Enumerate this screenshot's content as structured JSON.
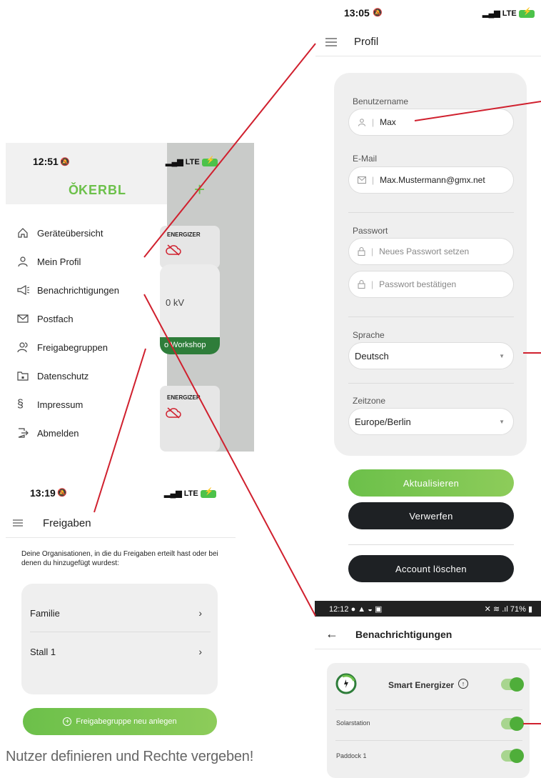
{
  "drawer": {
    "time": "12:51",
    "network": "LTE",
    "brand": "KERBL",
    "brand_mark": "Ǒ",
    "plus": "+",
    "items": [
      {
        "label": "Geräteübersicht",
        "icon": "home-icon"
      },
      {
        "label": "Mein Profil",
        "icon": "person-icon"
      },
      {
        "label": "Benachrichtigungen",
        "icon": "megaphone-icon"
      },
      {
        "label": "Postfach",
        "icon": "mail-icon"
      },
      {
        "label": "Freigabegruppen",
        "icon": "group-icon"
      },
      {
        "label": "Datenschutz",
        "icon": "folder-lock-icon"
      },
      {
        "label": "Impressum",
        "icon": "paragraph-icon"
      },
      {
        "label": "Abmelden",
        "icon": "logout-icon"
      }
    ],
    "bg_brand_1": "ENERGIZER",
    "bg_brand_2": "ENERGIZER",
    "bg_voltage": "0 kV",
    "bg_workshop": "o Workshop"
  },
  "profile": {
    "time": "13:05",
    "network": "LTE",
    "title": "Profil",
    "username_label": "Benutzername",
    "username_value": "Max",
    "email_label": "E-Mail",
    "email_value": "Max.Mustermann@gmx.net",
    "password_label": "Passwort",
    "password_placeholder": "Neues Passwort setzen",
    "password_confirm_placeholder": "Passwort bestätigen",
    "language_label": "Sprache",
    "language_value": "Deutsch",
    "timezone_label": "Zeitzone",
    "timezone_value": "Europe/Berlin",
    "update_button": "Aktualisieren",
    "discard_button": "Verwerfen",
    "delete_button": "Account löschen"
  },
  "sharing": {
    "time": "13:19",
    "network": "LTE",
    "title": "Freigaben",
    "description": "Deine Organisationen, in die du Freigaben erteilt hast oder bei denen du hinzugefügt wurdest:",
    "groups": [
      "Familie",
      "Stall 1"
    ],
    "new_group_button": "Freigabegruppe neu anlegen"
  },
  "notifications": {
    "time": "12:12",
    "battery": "71%",
    "title": "Benachrichtigungen",
    "device_name": "Smart Energizer",
    "rows": [
      "Solarstation",
      "Paddock 1"
    ],
    "toggles": [
      true,
      true,
      true
    ]
  },
  "caption": "Nutzer definieren und Rechte vergeben!",
  "colors": {
    "accent_green": "#6cc04a",
    "dark_button": "#1e2124",
    "workshop_green": "#2e7d3a",
    "annotation_red": "#d0202e"
  }
}
